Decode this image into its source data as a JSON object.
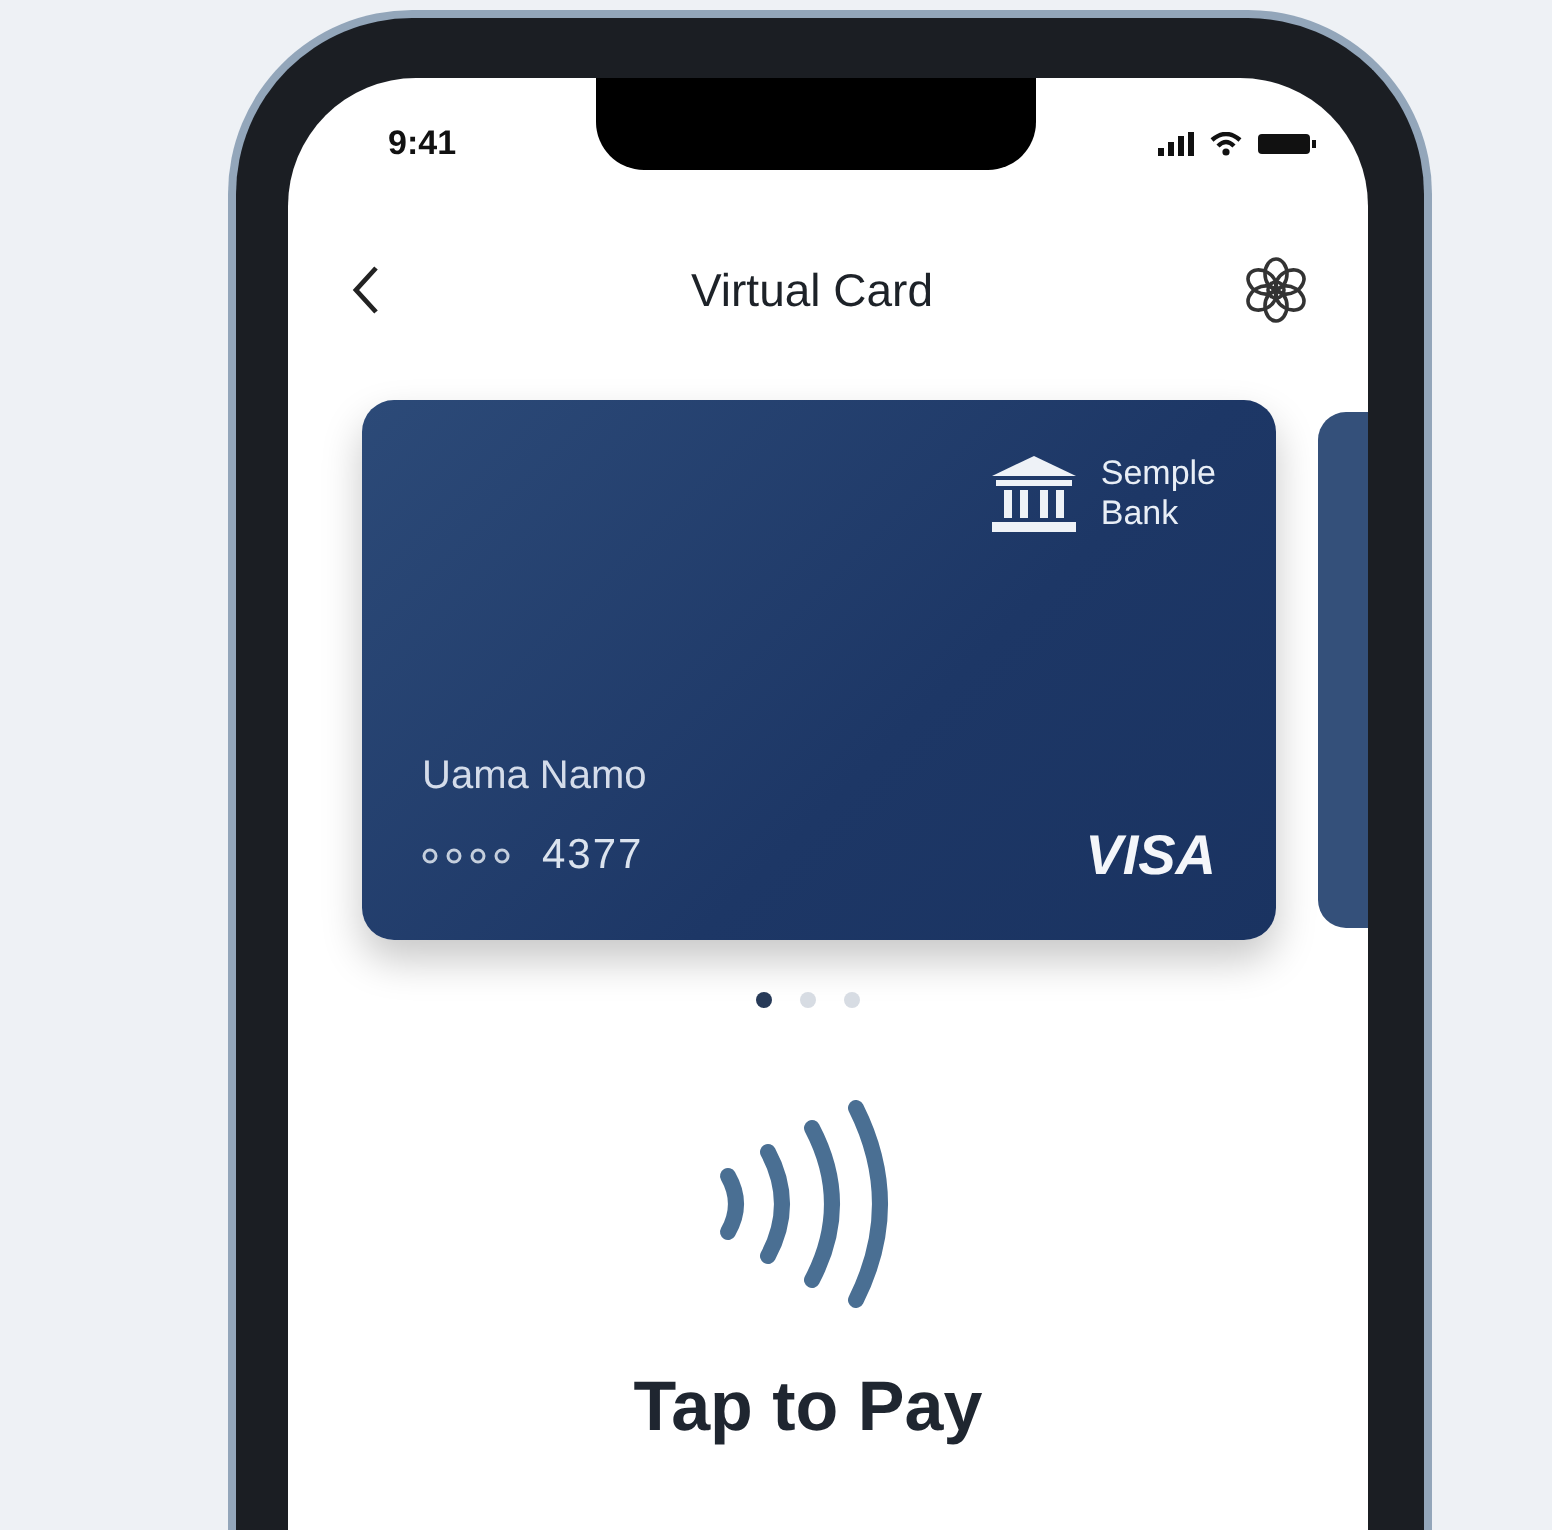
{
  "status_bar": {
    "time": "9:41"
  },
  "header": {
    "title": "Virtual Card"
  },
  "card": {
    "bank_name": [
      "Semple",
      "Bank"
    ],
    "holder": "Uama Namo",
    "number": "4377",
    "network": "VISA"
  },
  "pages": [
    {
      "selected": true
    },
    {
      "selected": false
    },
    {
      "selected": false
    }
  ],
  "action": {
    "label": "Tap to Pay"
  }
}
